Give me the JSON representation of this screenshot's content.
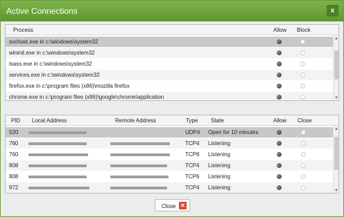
{
  "window": {
    "title": "Active Connections",
    "close_glyph": "x"
  },
  "processes": {
    "headers": {
      "process": "Process",
      "allow": "Allow",
      "block": "Block"
    },
    "rows": [
      {
        "path": "svchost.exe in c:\\windows\\system32",
        "state": "allow"
      },
      {
        "path": "wininit.exe in c:\\windows\\system32",
        "state": "allow"
      },
      {
        "path": "lsass.exe in c:\\windows\\system32",
        "state": "allow"
      },
      {
        "path": "services.exe in c:\\windows\\system32",
        "state": "allow"
      },
      {
        "path": "firefox.exe in c:\\program files (x86)\\mozilla firefox",
        "state": "allow"
      },
      {
        "path": "chrome.exe in c:\\program files (x86)\\google\\chrome\\application",
        "state": "allow"
      }
    ]
  },
  "connections": {
    "headers": {
      "pid": "PID",
      "local": "Local Address",
      "remote": "Remote Address",
      "type": "Type",
      "state": "State",
      "allow": "Allow",
      "close": "Close"
    },
    "rows": [
      {
        "pid": "520",
        "type": "UDP4",
        "state": "Open for 10 minutes"
      },
      {
        "pid": "760",
        "type": "TCP4",
        "state": "Listening"
      },
      {
        "pid": "760",
        "type": "TCP6",
        "state": "Listening"
      },
      {
        "pid": "808",
        "type": "TCP4",
        "state": "Listening"
      },
      {
        "pid": "808",
        "type": "TCP6",
        "state": "Listening"
      },
      {
        "pid": "972",
        "type": "TCP4",
        "state": "Listening"
      }
    ]
  },
  "footer": {
    "close_label": "Close"
  },
  "colors": {
    "titlebar": "#6aa33a",
    "close_icon": "#d84a38",
    "selected_row": "#c8c8c8"
  },
  "icons": {
    "window_close": "x-icon",
    "button_close": "close-x-icon"
  }
}
